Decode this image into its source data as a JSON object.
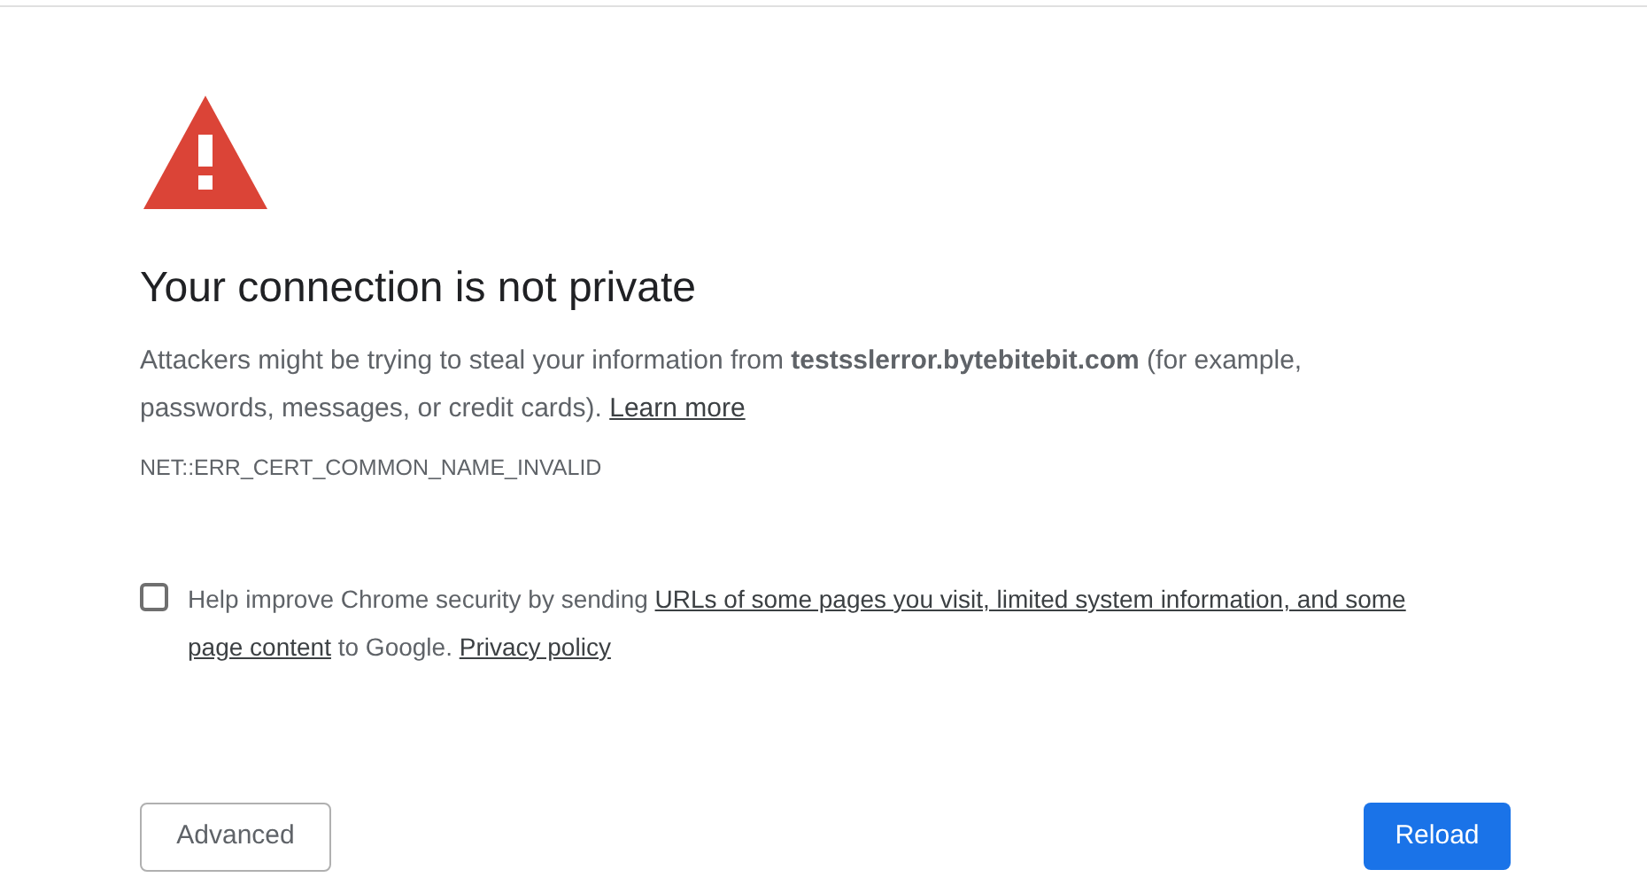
{
  "heading": "Your connection is not private",
  "description": {
    "text": "Attackers might be trying to steal your information from **testsslerror.bytebitebit.com** (for example, passwords, messages, or credit cards).",
    "link": "Learn more"
  },
  "error_code": "NET::ERR_CERT_COMMON_NAME_INVALID",
  "opt_in": {
    "checked": false,
    "parts": [
      {
        "kind": "text",
        "text": "Help improve Chrome security by sending"
      },
      {
        "kind": "link",
        "text": "URLs of some pages you visit, limited system information, and some"
      },
      {
        "kind": "link",
        "text": "page content"
      },
      {
        "kind": "text",
        "text": "to Google."
      },
      {
        "kind": "link",
        "text": "Privacy policy"
      }
    ]
  },
  "buttons": [
    {
      "label": "Advanced",
      "kind": "secondary"
    },
    {
      "label": "Reload",
      "kind": "primary"
    }
  ]
}
